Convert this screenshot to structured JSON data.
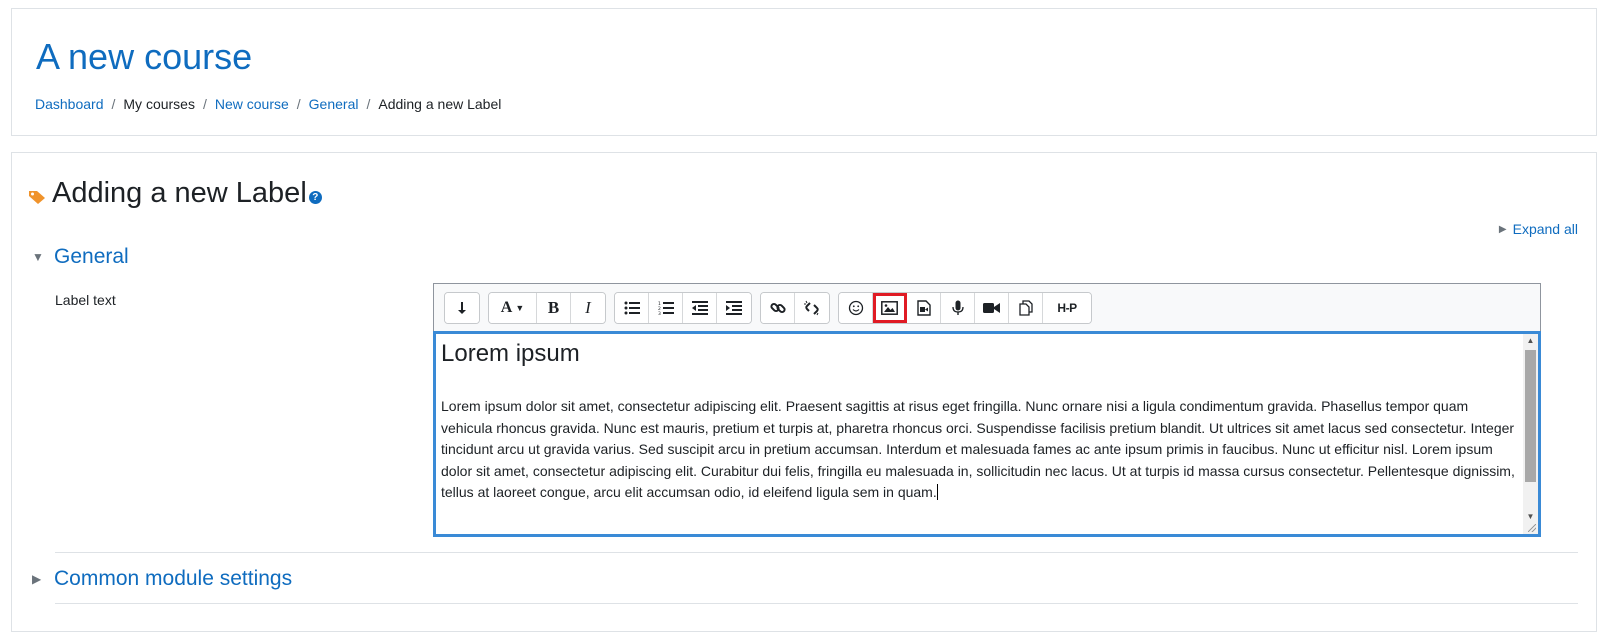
{
  "course": {
    "title": "A new course"
  },
  "breadcrumb": {
    "items": [
      "Dashboard",
      "My courses",
      "New course",
      "General",
      "Adding a new Label"
    ],
    "separator": "/"
  },
  "page": {
    "title": "Adding a new Label",
    "help_glyph": "?",
    "expand_all": "Expand all"
  },
  "sections": {
    "general": "General",
    "common": "Common module settings"
  },
  "form": {
    "label_text": "Label text"
  },
  "toolbar": {
    "font_label": "A",
    "bold": "B",
    "italic": "I",
    "h5p": "H-P",
    "highlighted_button": "image-icon"
  },
  "editor": {
    "heading": "Lorem ipsum",
    "paragraph": "Lorem ipsum dolor sit amet, consectetur adipiscing elit. Praesent sagittis at risus eget fringilla. Nunc ornare nisi a ligula condimentum gravida. Phasellus tempor quam vehicula rhoncus gravida. Nunc est mauris, pretium et turpis at, pharetra rhoncus orci. Suspendisse facilisis pretium blandit. Ut ultrices sit amet lacus sed consectetur. Integer tincidunt arcu ut gravida varius. Sed suscipit arcu in pretium accumsan. Interdum et malesuada fames ac ante ipsum primis in faucibus. Nunc ut efficitur nisl. Lorem ipsum dolor sit amet, consectetur adipiscing elit. Curabitur dui felis, fringilla eu malesuada in, sollicitudin nec lacus. Ut at turpis id massa cursus consectetur. Pellentesque dignissim, tellus at laoreet congue, arcu elit accumsan odio, id eleifend ligula sem in quam."
  },
  "colors": {
    "link": "#0f6cbf",
    "focus_border": "#3a8ad6",
    "highlight": "#e01b24",
    "tag_icon": "#f0932b"
  }
}
